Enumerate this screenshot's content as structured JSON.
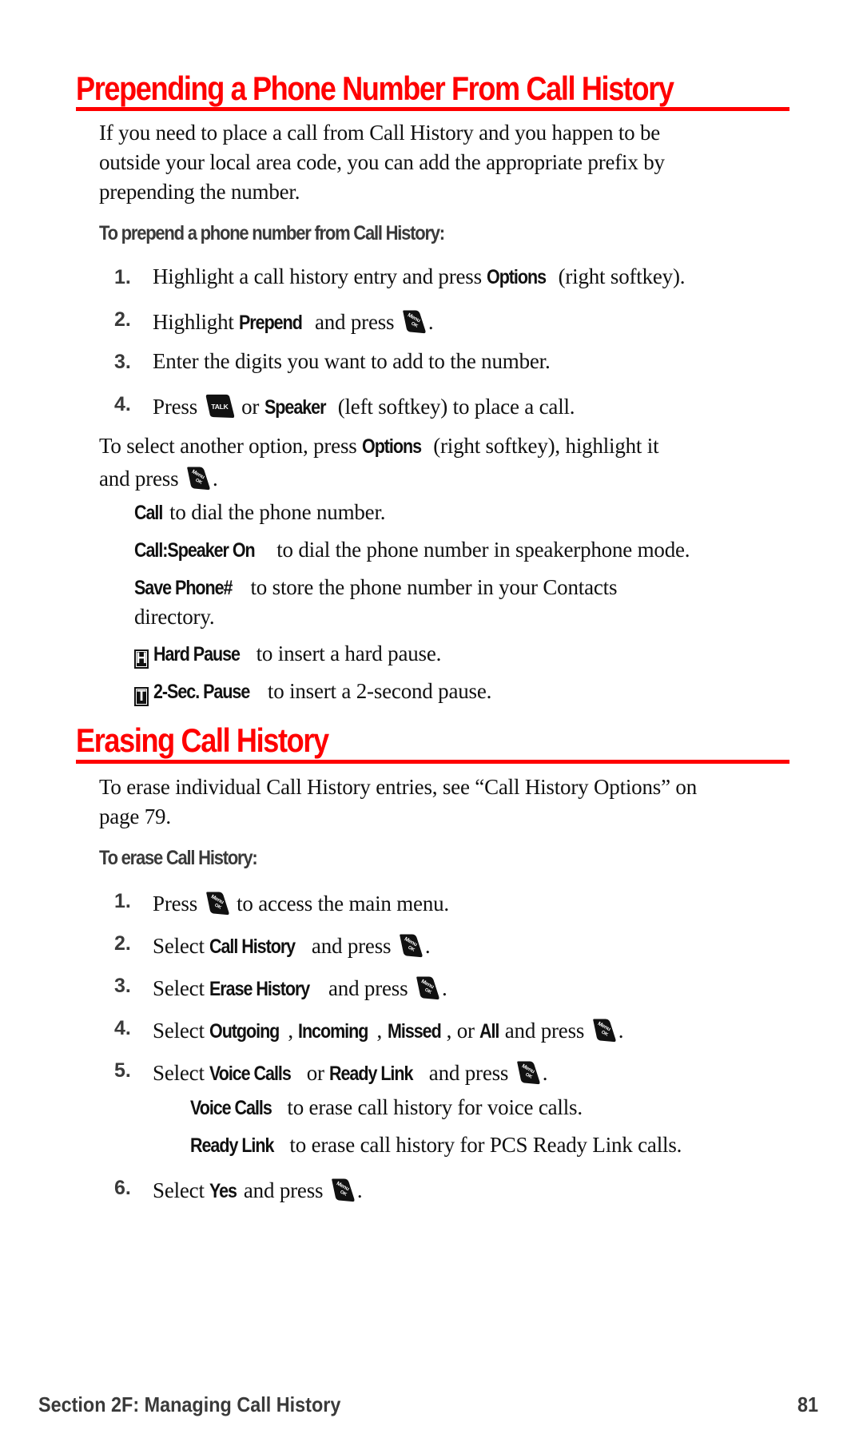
{
  "section1": {
    "title": "Prepending a Phone Number From Call History",
    "intro_lines": [
      "If you need to place a call from Call History and you happen to be",
      "outside your local area code, you can add the appropriate prefix by",
      "prepending the number."
    ],
    "procedure_heading": "To prepend a phone number from Call History:",
    "steps": [
      {
        "num": "1.",
        "pre": "Highlight a call history entry and press ",
        "b1": "Options",
        "post": " (right softkey)."
      },
      {
        "num": "2.",
        "pre": "Highlight ",
        "b1": "Prepend",
        "post": " and press ",
        "end": "."
      },
      {
        "num": "3.",
        "pre": "Enter the digits you want to add to the number."
      },
      {
        "num": "4.",
        "pre": "Press ",
        "mid": " or ",
        "b1": "Speaker",
        "post": " (left softkey) to place a call."
      }
    ],
    "options_intro": {
      "line1_pre": "To select another option, press ",
      "line1_bold": "Options",
      "line1_post": " (right softkey), highlight it",
      "line2_pre": "and press ",
      "line2_end": "."
    },
    "options": [
      {
        "bold": "Call",
        "text": " to dial the phone number."
      },
      {
        "bold": "Call:Speaker On",
        "text": " to dial the phone number in speakerphone mode."
      },
      {
        "bold": "Save Phone#",
        "text": " to store the phone number in your Contacts",
        "text2": "directory."
      },
      {
        "icon_letter": "H",
        "bold": "Hard Pause",
        "text": " to insert a hard pause."
      },
      {
        "icon_letter": "T",
        "bold": "2-Sec. Pause",
        "text": " to insert a 2-second pause."
      }
    ]
  },
  "section2": {
    "title": "Erasing Call History",
    "intro_lines": [
      "To erase individual Call History entries, see “Call History Options” on",
      "page 79."
    ],
    "procedure_heading": "To erase Call History:",
    "steps": [
      {
        "num": "1.",
        "pre": "Press ",
        "post": " to access the main menu."
      },
      {
        "num": "2.",
        "pre": "Select ",
        "b1": "Call History",
        "post": " and press ",
        "end": "."
      },
      {
        "num": "3.",
        "pre": "Select ",
        "b1": "Erase History",
        "post": " and press ",
        "end": "."
      },
      {
        "num": "4.",
        "pre": "Select ",
        "b1": "Outgoing",
        "s1": ", ",
        "b2": "Incoming",
        "s2": ", ",
        "b3": "Missed",
        "s3": ", or ",
        "b4": "All",
        "post": " and press ",
        "end": "."
      },
      {
        "num": "5.",
        "pre": "Select ",
        "b1": "Voice Calls",
        "s1": " or ",
        "b2": "Ready Link",
        "post": " and press ",
        "end": "."
      },
      {
        "num": "6.",
        "pre": "Select ",
        "b1": "Yes",
        "post": " and press ",
        "end": "."
      }
    ],
    "step5_options": [
      {
        "bold": "Voice Calls",
        "text": " to erase call history for voice calls."
      },
      {
        "bold": "Ready Link",
        "text": " to erase call history for PCS Ready Link calls."
      }
    ]
  },
  "keys": {
    "menu_top": "Menu",
    "menu_bottom": "OK",
    "talk": "TALK"
  },
  "footer": {
    "section": "Section 2F: Managing Call History",
    "page": "81"
  },
  "colors": {
    "heading": "#ff0000",
    "text": "#111111",
    "subheading": "#3a3a3a"
  }
}
